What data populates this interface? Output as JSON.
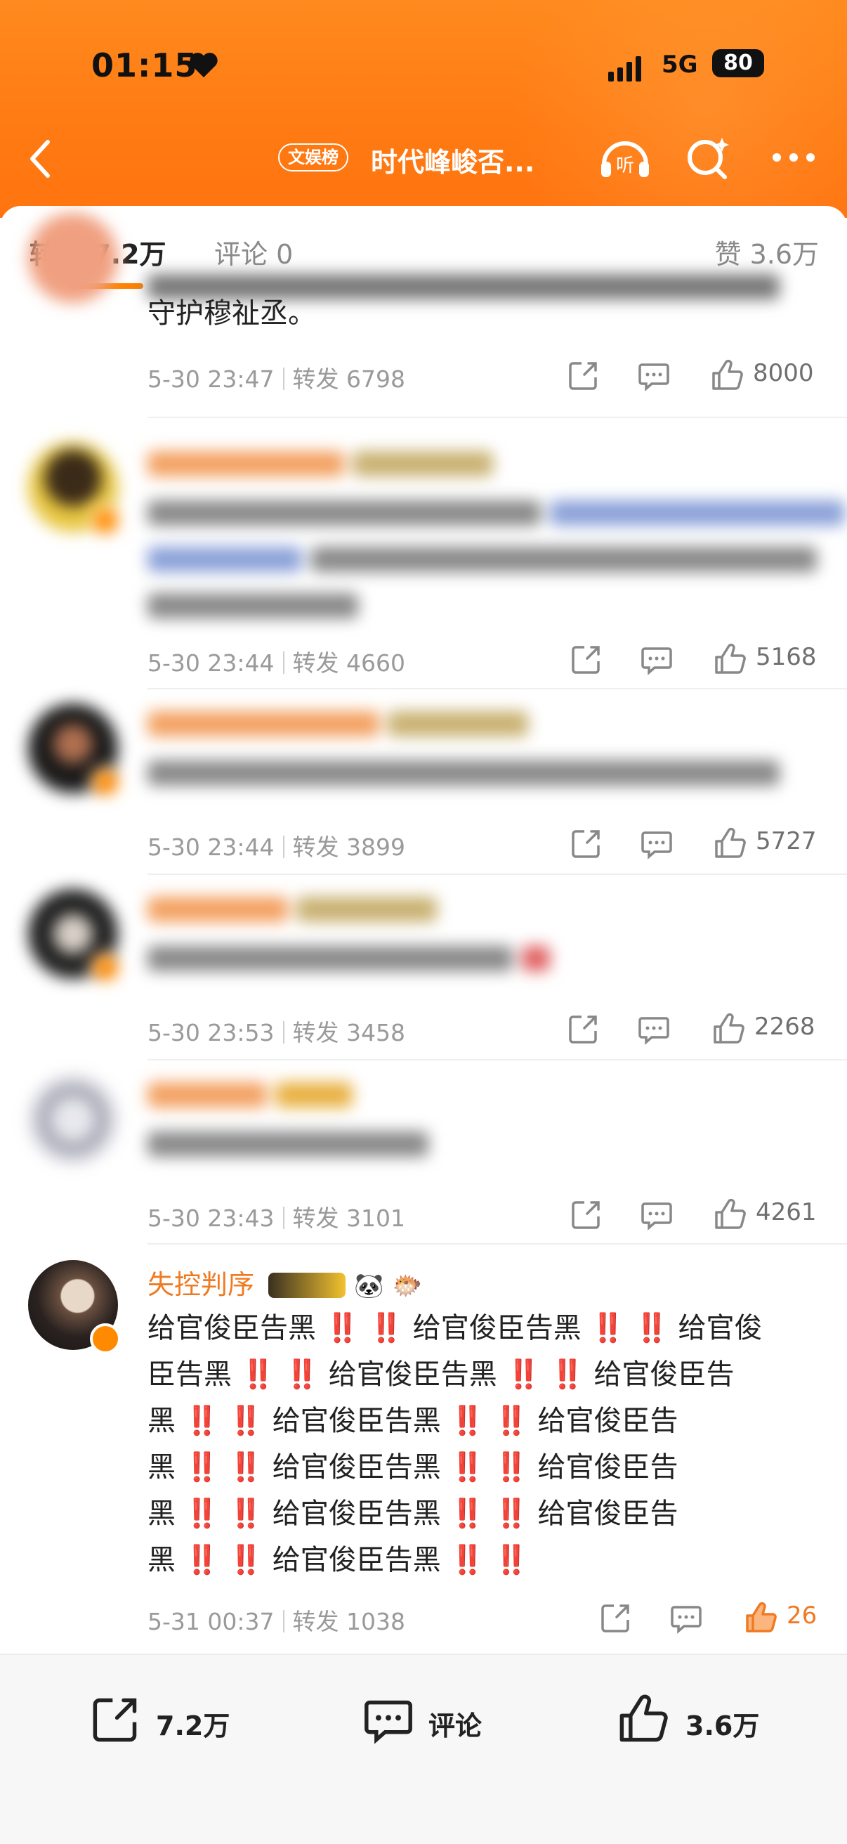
{
  "status": {
    "time": "01:15",
    "network": "5G",
    "battery": "80"
  },
  "nav": {
    "tag": "文娱榜",
    "title": "时代峰峻否..."
  },
  "tabs": {
    "repost": "转发 7.2万",
    "comment": "评论 0",
    "like": "赞 3.6万"
  },
  "items": [
    {
      "text": "守护穆祉丞。",
      "time": "5-30 23:47",
      "repost": "转发 6798",
      "likes": "8000"
    },
    {
      "time": "5-30 23:44",
      "repost": "转发 4660",
      "likes": "5168"
    },
    {
      "time": "5-30 23:44",
      "repost": "转发 3899",
      "likes": "5727"
    },
    {
      "time": "5-30 23:53",
      "repost": "转发 3458",
      "likes": "2268"
    },
    {
      "time": "5-30 23:43",
      "repost": "转发 3101",
      "likes": "4261"
    },
    {
      "name": "失控判序",
      "lines": [
        "给官俊臣告黑 ‼️ ‼️ 给官俊臣告黑 ‼️ ‼️ 给官俊",
        "臣告黑 ‼️ ‼️ 给官俊臣告黑 ‼️ ‼️ 给官俊臣告",
        "黑 ‼️ ‼️ 给官俊臣告黑 ‼️ ‼️ 给官俊臣告",
        "黑 ‼️ ‼️ 给官俊臣告黑 ‼️ ‼️ 给官俊臣告",
        "黑 ‼️ ‼️ 给官俊臣告黑 ‼️ ‼️ 给官俊臣告",
        "黑 ‼️ ‼️ 给官俊臣告黑 ‼️ ‼️"
      ],
      "time": "5-31 00:37",
      "repost": "转发 1038",
      "likes": "26"
    }
  ],
  "bottom": {
    "repost": "7.2万",
    "comment": "评论",
    "like": "3.6万"
  },
  "colors": {
    "brand": "#ff8200",
    "name": "#f07a22"
  }
}
